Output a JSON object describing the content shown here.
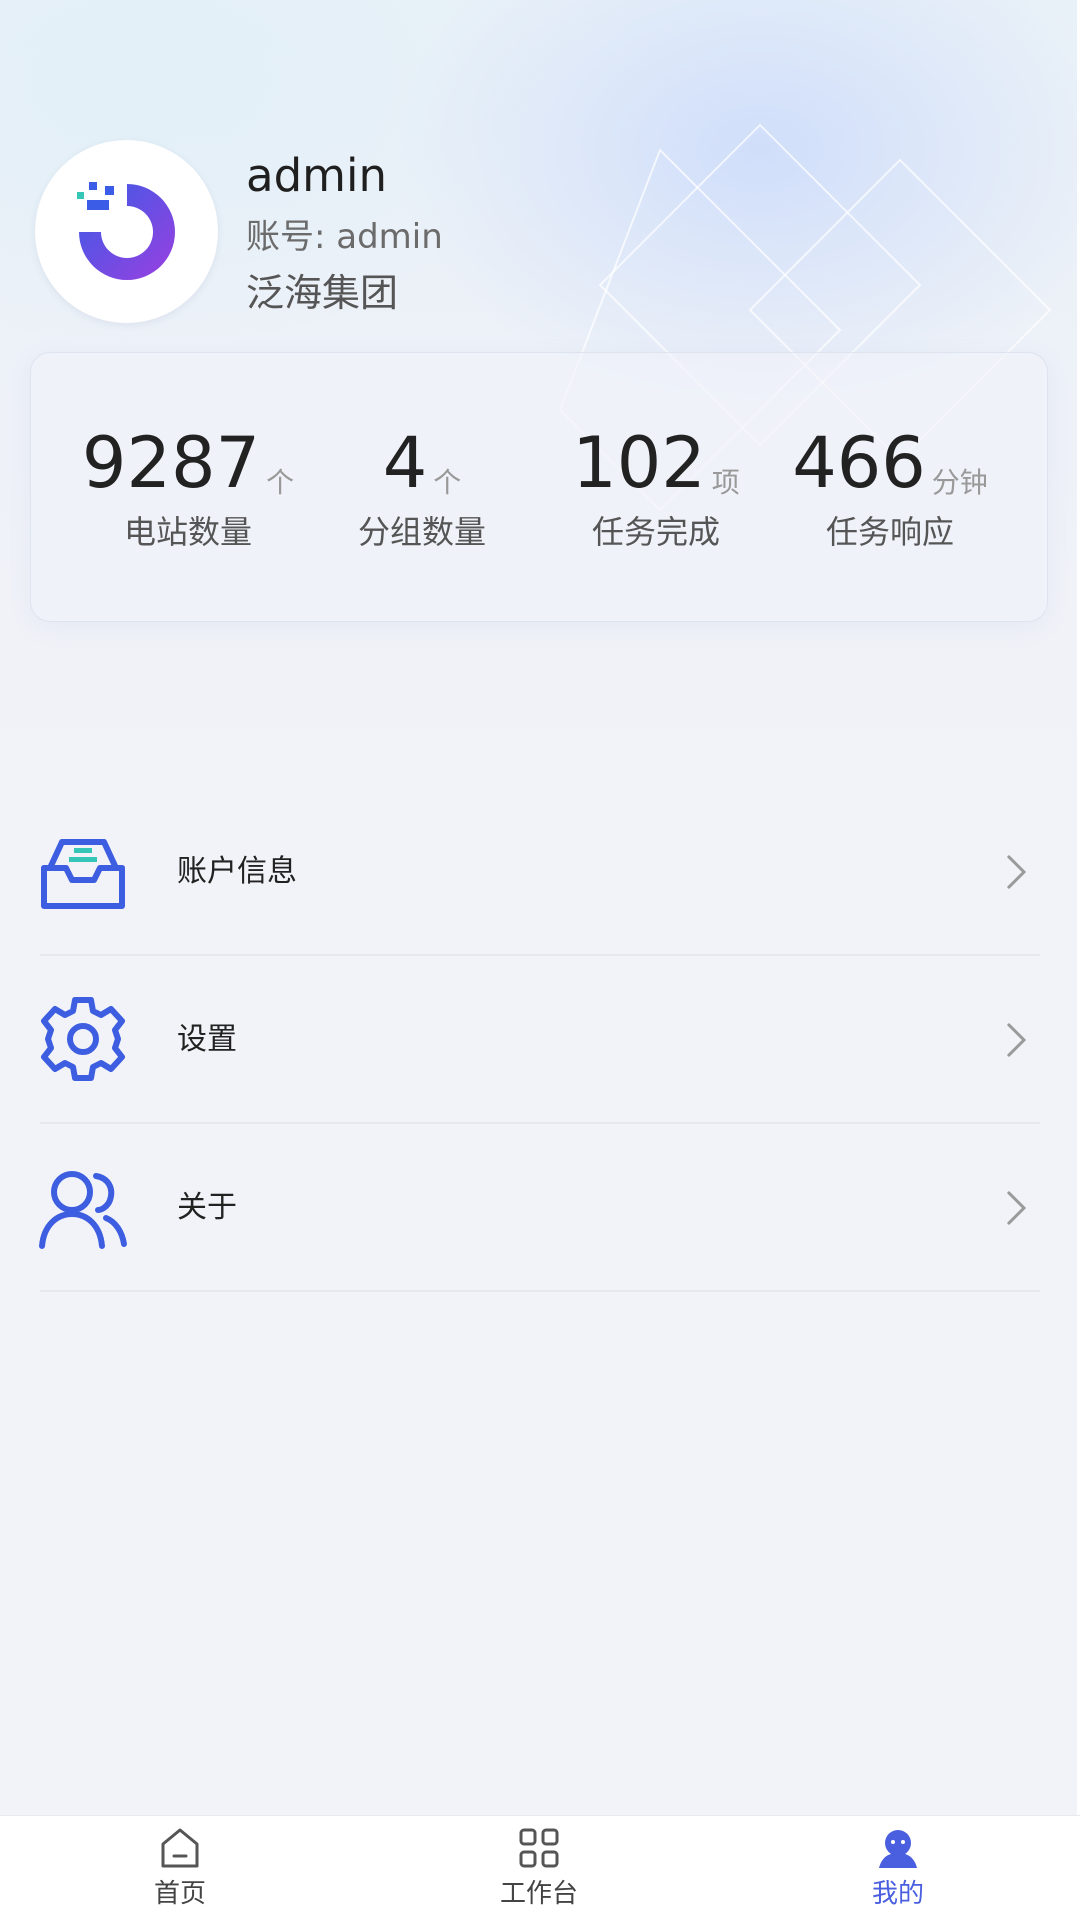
{
  "profile": {
    "username": "admin",
    "account": "账号: admin",
    "company": "泛海集团",
    "avatar_icon": "brand-logo-icon"
  },
  "stats": [
    {
      "value": "9287",
      "unit": "个",
      "label": "电站数量"
    },
    {
      "value": "4",
      "unit": "个",
      "label": "分组数量"
    },
    {
      "value": "102",
      "unit": "项",
      "label": "任务完成"
    },
    {
      "value": "466",
      "unit": "分钟",
      "label": "任务响应"
    }
  ],
  "menu": [
    {
      "label": "账户信息",
      "icon": "inbox-icon"
    },
    {
      "label": "设置",
      "icon": "gear-icon"
    },
    {
      "label": "关于",
      "icon": "users-icon"
    }
  ],
  "tabs": [
    {
      "label": "首页",
      "icon": "home-icon",
      "active": false
    },
    {
      "label": "工作台",
      "icon": "grid-icon",
      "active": false
    },
    {
      "label": "我的",
      "icon": "user-icon",
      "active": true
    }
  ],
  "colors": {
    "accent": "#4a5fe0",
    "icon_blue": "#3d5ee0",
    "logo_gradient_start": "#3a5ce6",
    "logo_gradient_end": "#9b3fe0",
    "logo_accent": "#35c6b8"
  }
}
